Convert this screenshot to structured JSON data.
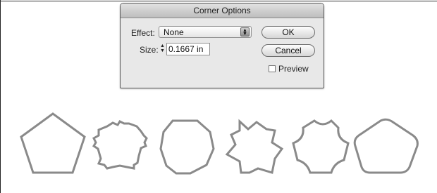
{
  "dialog": {
    "title": "Corner Options",
    "effect_label": "Effect:",
    "effect_value": "None",
    "size_label": "Size:",
    "size_value": "0.1667 in",
    "ok_label": "OK",
    "cancel_label": "Cancel",
    "preview_label": "Preview",
    "preview_checked": false
  },
  "shapes": [
    {
      "name": "pentagon-plain"
    },
    {
      "name": "pentagon-fancy-corners"
    },
    {
      "name": "pentagon-bevel-corners"
    },
    {
      "name": "pentagon-inset-corners"
    },
    {
      "name": "pentagon-inverse-rounded-corners"
    },
    {
      "name": "pentagon-rounded-corners"
    }
  ]
}
